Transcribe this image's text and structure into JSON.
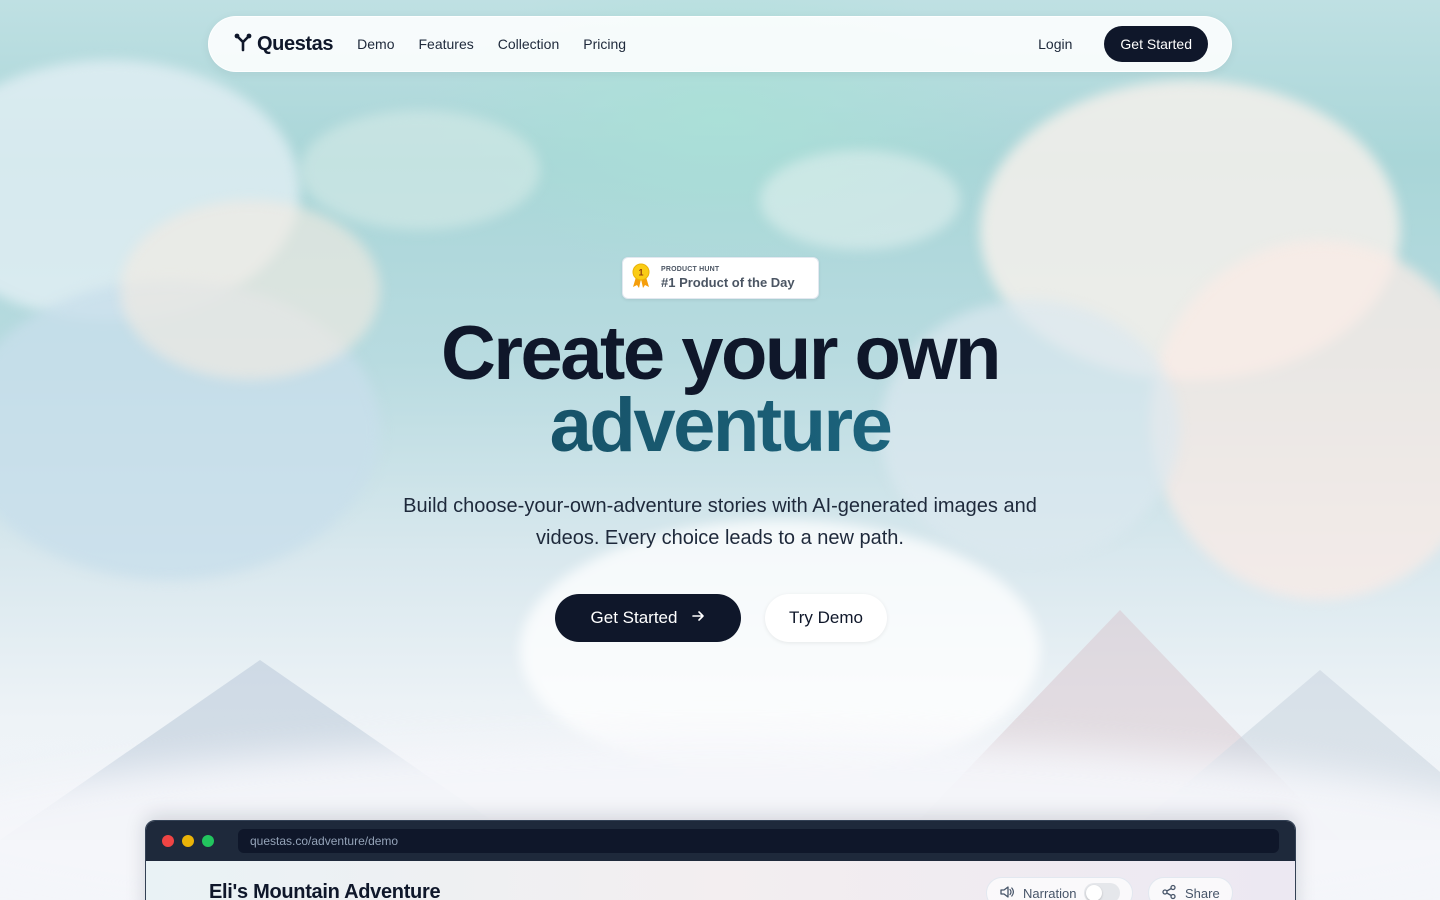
{
  "nav": {
    "logo_text": "Questas",
    "links": [
      "Demo",
      "Features",
      "Collection",
      "Pricing"
    ],
    "login": "Login",
    "cta": "Get Started"
  },
  "badge": {
    "small": "PRODUCT HUNT",
    "big": "#1 Product of the Day",
    "medal_number": "1"
  },
  "hero": {
    "title_line1": "Create your own",
    "title_line2": "adventure",
    "subtitle": "Build choose-your-own-adventure stories with AI-generated images and videos. Every choice leads to a new path.",
    "primary_cta": "Get Started",
    "secondary_cta": "Try Demo"
  },
  "browser": {
    "url": "questas.co/adventure/demo",
    "story_title": "Eli's Mountain Adventure",
    "narration_label": "Narration",
    "narration_on": false,
    "share_label": "Share"
  },
  "colors": {
    "dark": "#0f172a",
    "accent_teal": "#1a5e76",
    "dot_red": "#ef4444",
    "dot_yellow": "#eab308",
    "dot_green": "#22c55e"
  }
}
